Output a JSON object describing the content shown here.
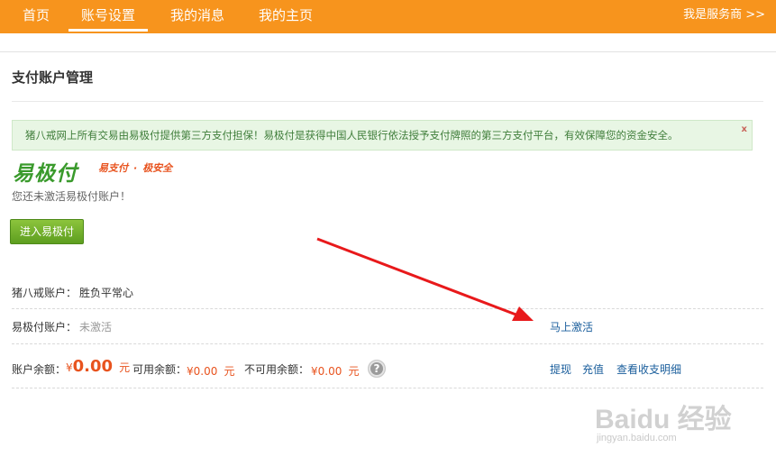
{
  "nav": {
    "items": [
      {
        "label": "首页"
      },
      {
        "label": "账号设置"
      },
      {
        "label": "我的消息"
      },
      {
        "label": "我的主页"
      }
    ],
    "right_link": "我是服务商 >>"
  },
  "page": {
    "title": "支付账户管理"
  },
  "notice": {
    "text": "猪八戒网上所有交易由易极付提供第三方支付担保！易极付是获得中国人民银行依法授予支付牌照的第三方支付平台，有效保障您的资金安全。",
    "close": "x"
  },
  "brand": {
    "logo": "易极付",
    "slogan_1": "易支付",
    "slogan_2": "极安全"
  },
  "status": {
    "inactive_message": "您还未激活易极付账户！",
    "enter_button": "进入易极付"
  },
  "accounts": {
    "zbj_label": "猪八戒账户：",
    "zbj_value": "胜负平常心",
    "yjf_label": "易极付账户：",
    "yjf_value": "未激活",
    "activate_link": "马上激活"
  },
  "balance": {
    "label": "账户余额：",
    "currency": "¥",
    "amount": "0.00",
    "unit": "元",
    "available_label": "可用余额：",
    "available_amount": "0.00",
    "unavailable_label": "不可用余额：",
    "unavailable_amount": "0.00",
    "help": "?",
    "withdraw_link": "提现",
    "recharge_link": "充值",
    "details_link": "查看收支明细"
  },
  "watermark": {
    "text": "Baidu 经验",
    "url": "jingyan.baidu.com"
  },
  "colors": {
    "nav_bg": "#f7941d",
    "accent_orange": "#e8531e",
    "link_blue": "#1a5e9c",
    "notice_bg": "#e8f6e4",
    "button_green": "#6aaa24",
    "arrow_red": "#e8191b"
  }
}
